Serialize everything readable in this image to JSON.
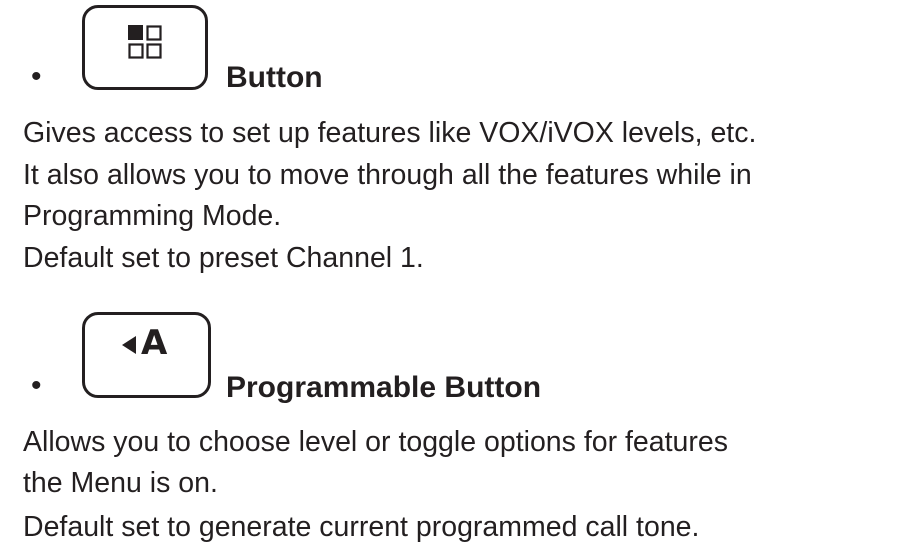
{
  "sections": [
    {
      "bullet": "•",
      "icon": "menu-grid-icon",
      "heading": "Button",
      "lines": [
        "Gives access to set up features like VOX/iVOX levels, etc.",
        "It also allows you to move through all the features while in",
        "Programming Mode.",
        "Default set to preset Channel 1."
      ]
    },
    {
      "bullet": "•",
      "icon": "left-a-icon",
      "icon_letter": "A",
      "heading": "Programmable Button",
      "lines": [
        "Allows you to choose level or toggle options for features",
        "the Menu is on.",
        "Default set to generate current programmed call tone."
      ]
    }
  ]
}
